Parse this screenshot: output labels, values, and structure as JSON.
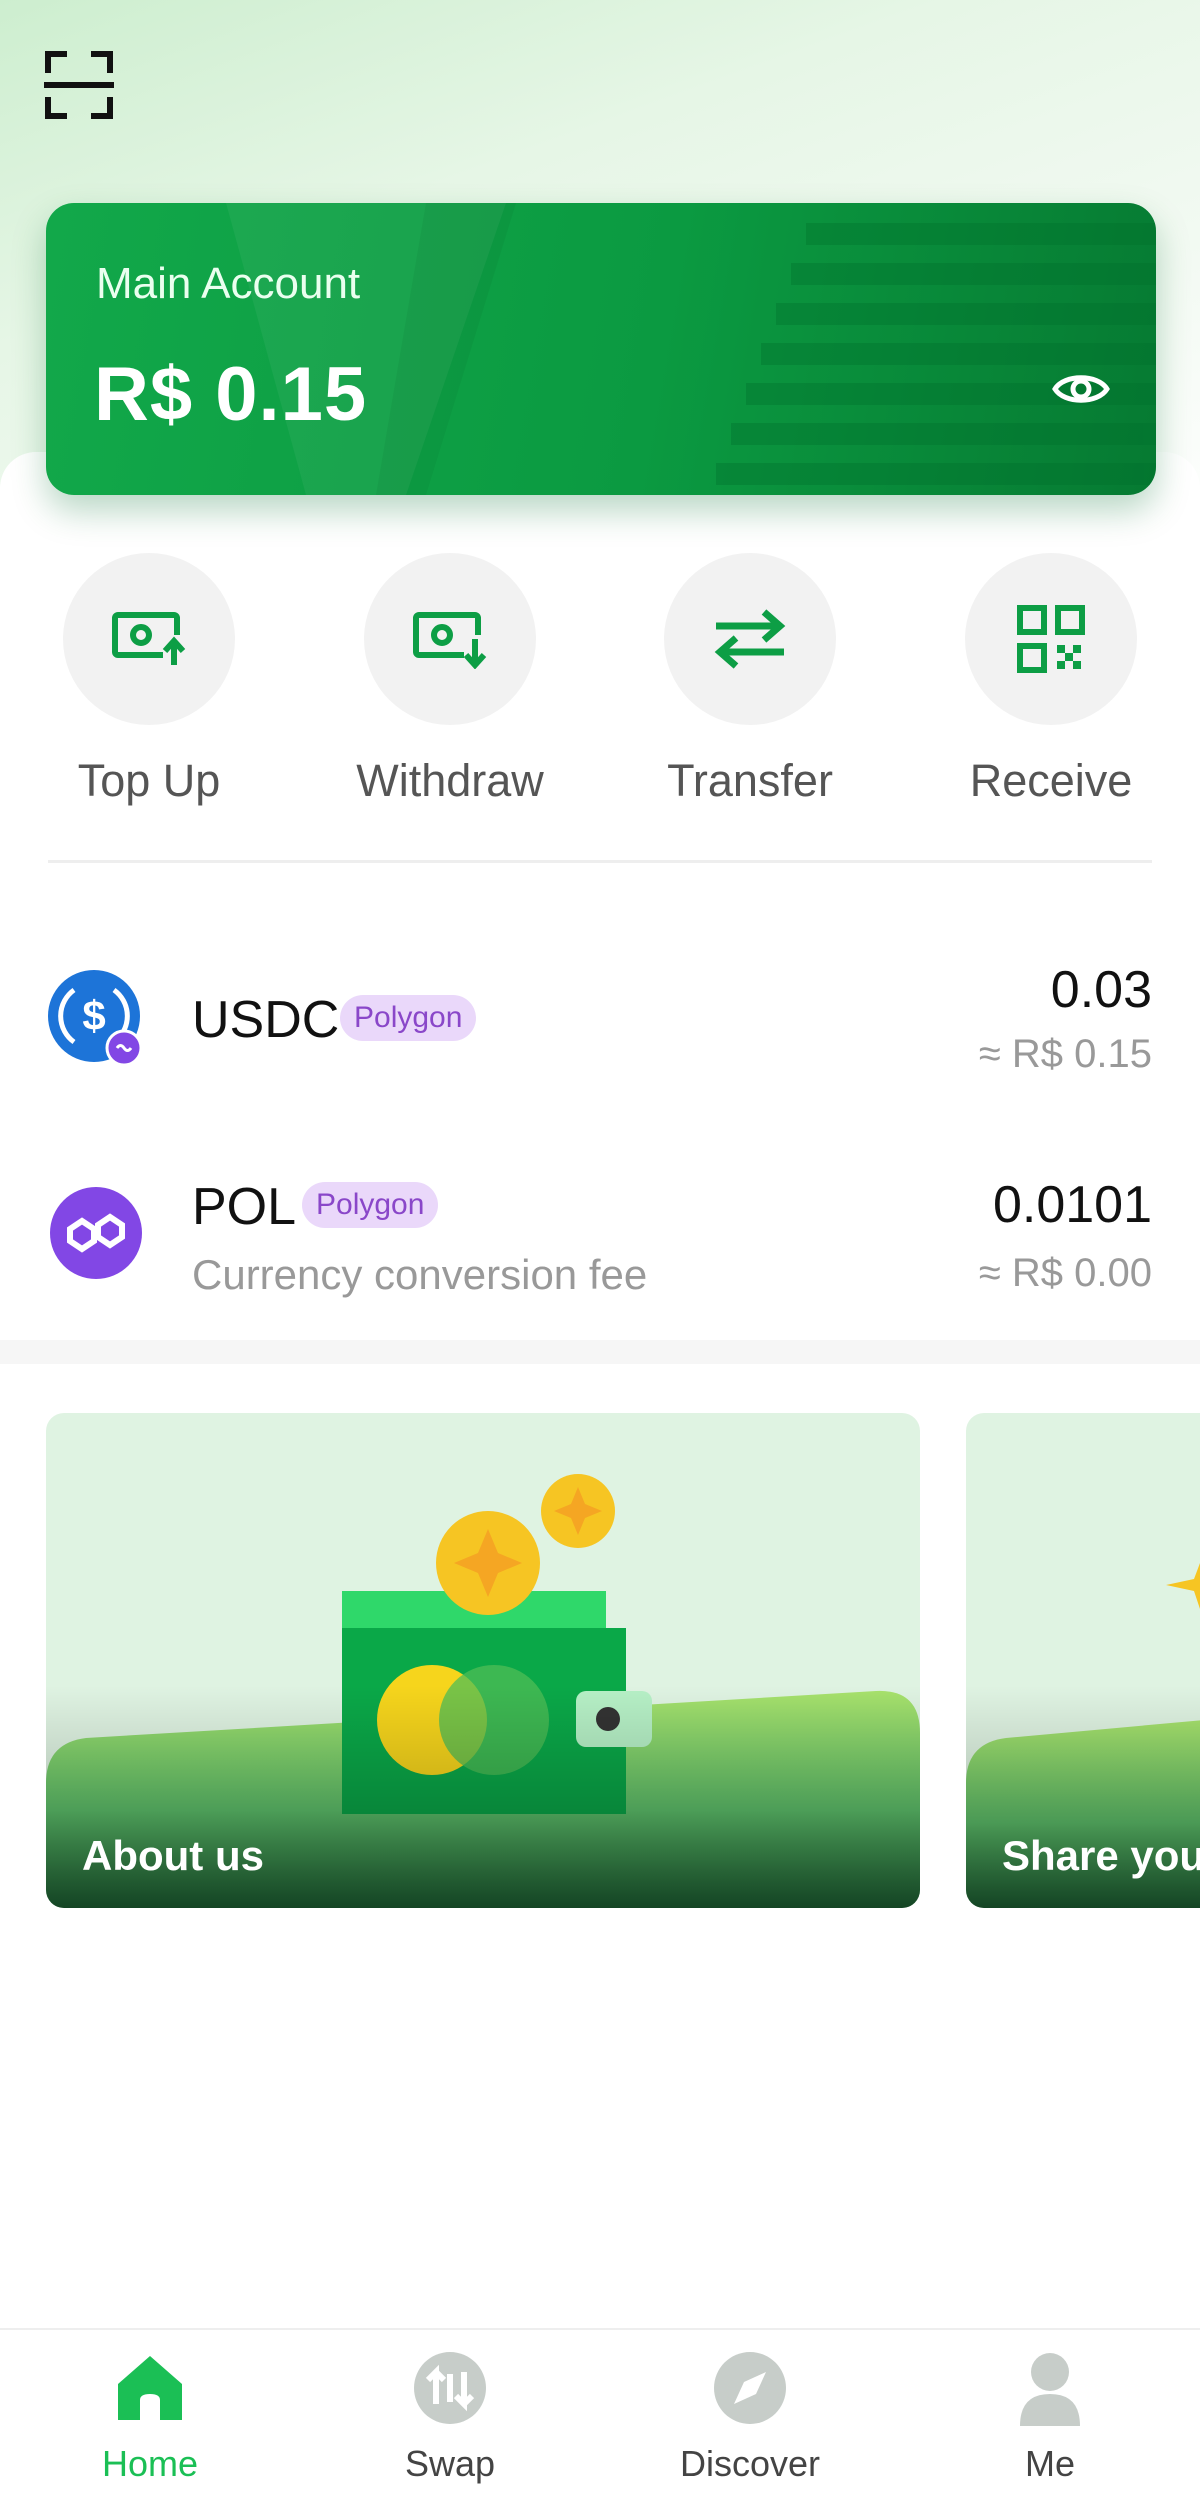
{
  "header": {
    "scan_icon": "scan-icon"
  },
  "account": {
    "label": "Main Account",
    "balance": "R$ 0.15",
    "visibility_icon": "eye-icon"
  },
  "actions": [
    {
      "label": "Top Up",
      "icon": "money-up-icon"
    },
    {
      "label": "Withdraw",
      "icon": "money-down-icon"
    },
    {
      "label": "Transfer",
      "icon": "transfer-arrows-icon"
    },
    {
      "label": "Receive",
      "icon": "qr-code-icon"
    }
  ],
  "tokens": [
    {
      "symbol": "USDC",
      "chain": "Polygon",
      "subtitle": "",
      "amount": "0.03",
      "fiat": "≈ R$ 0.15"
    },
    {
      "symbol": "POL",
      "chain": "Polygon",
      "subtitle": "Currency conversion fee",
      "amount": "0.0101",
      "fiat": "≈ R$ 0.00"
    }
  ],
  "banners": [
    {
      "title": "About us"
    },
    {
      "title": "Share your"
    }
  ],
  "nav": [
    {
      "label": "Home",
      "icon": "home-icon",
      "active": true
    },
    {
      "label": "Swap",
      "icon": "swap-icon",
      "active": false
    },
    {
      "label": "Discover",
      "icon": "compass-icon",
      "active": false
    },
    {
      "label": "Me",
      "icon": "person-icon",
      "active": false
    }
  ],
  "colors": {
    "accent": "#0d9e45",
    "nav_active": "#1bbf55",
    "badge_bg": "#ead8fa",
    "badge_text": "#8a47c9"
  }
}
